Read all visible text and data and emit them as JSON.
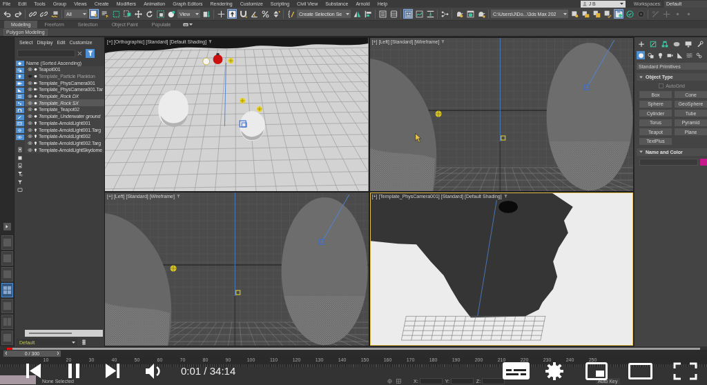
{
  "menu_bar": {
    "items": [
      "File",
      "Edit",
      "Tools",
      "Group",
      "Views",
      "Create",
      "Modifiers",
      "Animation",
      "Graph Editors",
      "Rendering",
      "Customize",
      "Scripting",
      "Civil View",
      "Substance",
      "Arnold",
      "Help"
    ],
    "user": "J B",
    "workspaces_label": "Workspaces:",
    "workspace": "Default"
  },
  "toolbar": {
    "groups": [
      [
        {
          "kind": "button",
          "on": false
        },
        {
          "kind": "button",
          "on": false
        }
      ],
      [
        {
          "kind": "button",
          "on": false
        },
        {
          "kind": "button",
          "on": false
        },
        {
          "kind": "button",
          "on": false
        }
      ],
      [
        {
          "kind": "dropdown",
          "value": "All"
        },
        {
          "kind": "button",
          "on": true
        },
        {
          "kind": "button",
          "on": false
        },
        {
          "kind": "button",
          "on": false
        },
        {
          "kind": "button",
          "on": false
        },
        {
          "kind": "button",
          "on": false
        },
        {
          "kind": "button",
          "on": false
        },
        {
          "kind": "button",
          "on": false
        },
        {
          "kind": "button",
          "on": false
        },
        {
          "kind": "dropdown",
          "value": "View"
        },
        {
          "kind": "button",
          "on": false
        }
      ],
      [
        {
          "kind": "button",
          "on": false
        },
        {
          "kind": "button",
          "on": true
        },
        {
          "kind": "button",
          "on": false
        },
        {
          "kind": "button",
          "on": false
        },
        {
          "kind": "button",
          "on": false
        },
        {
          "kind": "button",
          "on": false
        }
      ],
      [
        {
          "kind": "button",
          "on": false
        },
        {
          "kind": "dropdown",
          "value": "Create Selection Se"
        },
        {
          "kind": "button",
          "on": false
        },
        {
          "kind": "button",
          "on": false
        }
      ],
      [
        {
          "kind": "button",
          "on": false
        },
        {
          "kind": "button",
          "on": false
        }
      ],
      [
        {
          "kind": "button",
          "on": true
        },
        {
          "kind": "button",
          "on": false
        },
        {
          "kind": "button",
          "on": false
        }
      ],
      [
        {
          "kind": "button",
          "on": false
        }
      ],
      [
        {
          "kind": "button",
          "on": false
        },
        {
          "kind": "button",
          "on": false
        },
        {
          "kind": "button",
          "on": false
        }
      ],
      [
        {
          "kind": "dropdown",
          "value": "C:\\Users\\J\\Do...\\3ds Max 202"
        },
        {
          "kind": "button",
          "on": false
        },
        {
          "kind": "button",
          "on": false
        },
        {
          "kind": "button",
          "on": false
        },
        {
          "kind": "button",
          "on": false
        },
        {
          "kind": "button",
          "on": true
        },
        {
          "kind": "button",
          "on": false
        },
        {
          "kind": "button",
          "on": false
        }
      ],
      [
        {
          "kind": "button",
          "on": false
        },
        {
          "kind": "button",
          "on": false
        },
        {
          "kind": "button",
          "on": false
        },
        {
          "kind": "button",
          "on": false
        }
      ]
    ]
  },
  "ribbon": {
    "tabs": [
      {
        "label": "Modeling",
        "selected": true
      },
      {
        "label": "Freeform",
        "selected": false
      },
      {
        "label": "Selection",
        "selected": false
      },
      {
        "label": "Object Paint",
        "selected": false
      },
      {
        "label": "Populate",
        "selected": false
      }
    ],
    "panel": "Polygon Modeling"
  },
  "viewport_layouts": [
    {
      "selected": false
    },
    {
      "selected": false
    },
    {
      "selected": false
    },
    {
      "selected": true
    },
    {
      "selected": false
    },
    {
      "selected": false
    },
    {
      "selected": false
    }
  ],
  "scene_explorer": {
    "menu": [
      "Select",
      "Display",
      "Edit",
      "Customize"
    ],
    "filters": [
      {
        "on": true
      },
      {
        "on": true
      },
      {
        "on": true
      },
      {
        "on": true
      },
      {
        "on": true
      },
      {
        "on": true
      },
      {
        "on": true
      },
      {
        "on": true
      },
      {
        "on": true
      },
      {
        "on": true
      },
      {
        "on": true
      },
      {
        "on": true
      }
    ],
    "options": [
      {
        "on": false
      },
      {
        "on": false
      },
      {
        "on": false
      },
      {
        "on": false
      },
      {
        "on": false
      },
      {
        "on": false
      }
    ],
    "column_header": "Name (Sorted Ascending)",
    "rows": [
      {
        "name": "Teapot001",
        "kind": "geometry",
        "visible": true,
        "italic": false,
        "selected": false
      },
      {
        "name": "Template_Particle Plankton",
        "kind": "geometry",
        "visible": false,
        "italic": false,
        "selected": false
      },
      {
        "name": "Template_PhysCamera001",
        "kind": "camera",
        "visible": true,
        "italic": false,
        "selected": false
      },
      {
        "name": "Template_PhysCamera001.Tar",
        "kind": "camera",
        "visible": true,
        "italic": false,
        "selected": false
      },
      {
        "name": "Template_Rock DX",
        "kind": "geometry",
        "visible": true,
        "italic": true,
        "selected": false
      },
      {
        "name": "Template_Rock SX",
        "kind": "geometry",
        "visible": true,
        "italic": true,
        "selected": true
      },
      {
        "name": "Template_Teapot02",
        "kind": "geometry",
        "visible": true,
        "italic": false,
        "selected": false
      },
      {
        "name": "Template_Underwater ground",
        "kind": "geometry",
        "visible": true,
        "italic": true,
        "selected": false
      },
      {
        "name": "Template-ArnoldLight001",
        "kind": "light",
        "visible": true,
        "italic": false,
        "selected": false
      },
      {
        "name": "Template-ArnoldLight001.Targ",
        "kind": "light",
        "visible": true,
        "italic": false,
        "selected": false
      },
      {
        "name": "Template-ArnoldLight002",
        "kind": "light",
        "visible": true,
        "italic": false,
        "selected": false
      },
      {
        "name": "Template-ArnoldLight002.Targ",
        "kind": "light",
        "visible": true,
        "italic": false,
        "selected": false
      },
      {
        "name": "Template-ArnoldLightSkydome",
        "kind": "light",
        "visible": true,
        "italic": false,
        "selected": false
      }
    ],
    "layer": "Default"
  },
  "viewports": [
    {
      "label": "[+] [Orthographic] [Standard] [Default Shading]",
      "kind": "terrain",
      "active": false
    },
    {
      "label": "[+] [Left] [Standard] [Wireframe]",
      "kind": "wireframe",
      "active": false
    },
    {
      "label": "[+] [Left] [Standard] [Wireframe]",
      "kind": "wireframe",
      "active": false
    },
    {
      "label": "[+] [Template_PhysCamera001] [Standard] [Default Shading]",
      "kind": "camera",
      "active": true
    }
  ],
  "command_panel": {
    "categories": [
      {
        "selected": true
      },
      {
        "selected": false
      },
      {
        "selected": false
      },
      {
        "selected": false
      },
      {
        "selected": false
      },
      {
        "selected": false
      },
      {
        "selected": false
      }
    ],
    "dropdown": "Standard Primitives",
    "object_type": {
      "title": "Object Type",
      "expanded": true,
      "autogrid": {
        "label": "AutoGrid",
        "checked": false,
        "disabled": true
      },
      "buttons": [
        "Box",
        "Cone",
        "Sphere",
        "GeoSphere",
        "Cylinder",
        "Tube",
        "Torus",
        "Pyramid",
        "Teapot",
        "Plane",
        "TextPlus"
      ]
    },
    "name_and_color": {
      "title": "Name and Color",
      "expanded": true,
      "color": "#c8198c"
    }
  },
  "timeline": {
    "frame": "0 / 300",
    "ticks": [
      "10",
      "20",
      "30",
      "40",
      "50",
      "60",
      "70",
      "80",
      "90",
      "100",
      "110",
      "120",
      "130",
      "140",
      "150",
      "160",
      "170",
      "180",
      "190",
      "200",
      "210",
      "220",
      "230",
      "240",
      "250"
    ]
  },
  "status_bar": {
    "selection": "None Selected",
    "coordinates": [
      "X:",
      "Y:",
      "Z:"
    ],
    "auto_key": "Auto Key"
  },
  "player": {
    "progress": {
      "level": 0.008
    },
    "time": "0:01 / 34:14"
  }
}
